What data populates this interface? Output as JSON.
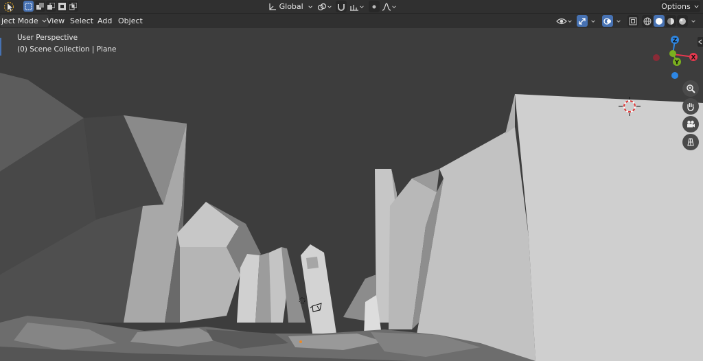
{
  "topbar": {
    "transform_orientation": "Global",
    "options_label": "Options"
  },
  "header": {
    "mode_label": "ject Mode",
    "menus": [
      "View",
      "Select",
      "Add",
      "Object"
    ]
  },
  "viewport": {
    "perspective_label": "User Perspective",
    "collection_label": "(0) Scene Collection | Plane",
    "gizmo": {
      "z_label": "Z",
      "y_label": "Y",
      "x_label": "X"
    }
  },
  "colors": {
    "accent": "#4772b3",
    "gizmo_x": "#e5384e",
    "gizmo_y": "#7bb01e",
    "gizmo_z": "#2e87e4",
    "background": "#3d3d3d",
    "header": "#303030"
  }
}
